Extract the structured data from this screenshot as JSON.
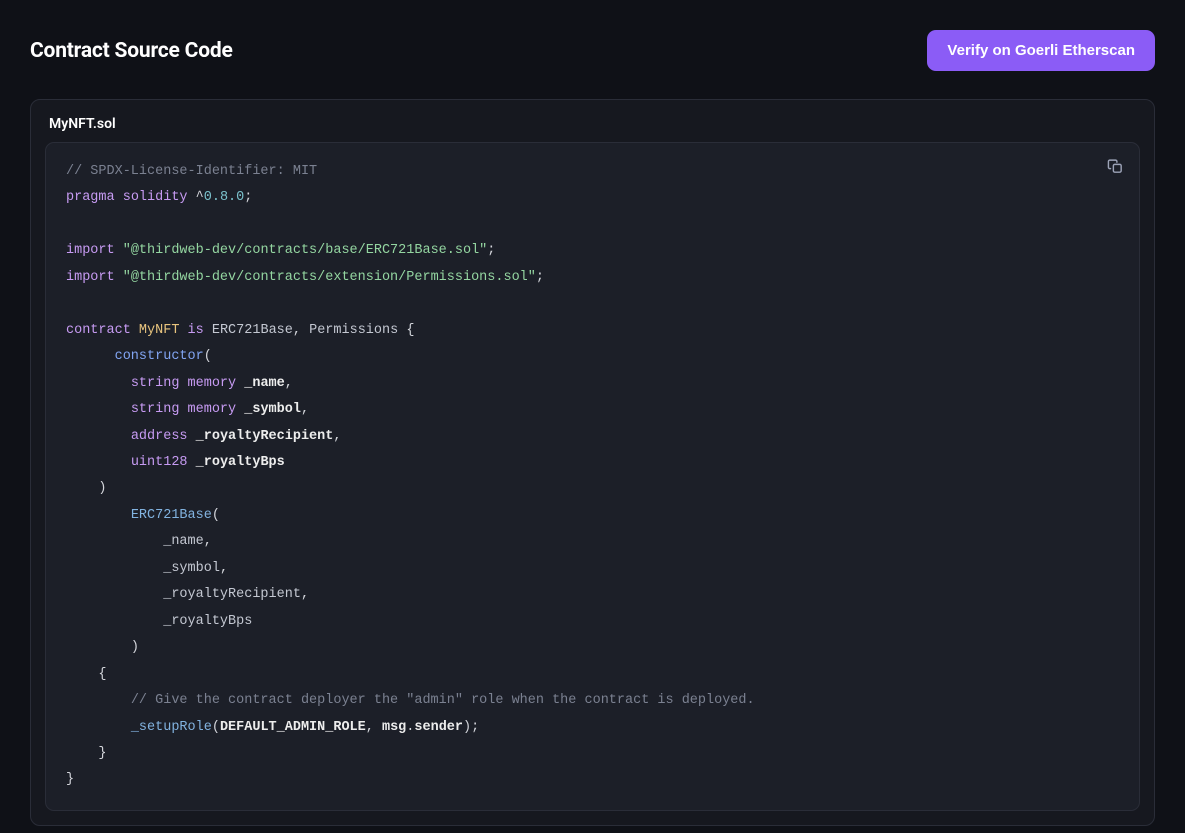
{
  "header": {
    "title": "Contract Source Code",
    "verify_label": "Verify on Goerli Etherscan"
  },
  "source": {
    "filename": "MyNFT.sol",
    "code": {
      "line1_comment": "// SPDX-License-Identifier: MIT",
      "line2_kw1": "pragma",
      "line2_kw2": "solidity",
      "line2_caret": "^",
      "line2_ver": "0.8.0",
      "line2_semi": ";",
      "import_kw": "import",
      "import1_str": "\"@thirdweb-dev/contracts/base/ERC721Base.sol\"",
      "import2_str": "\"@thirdweb-dev/contracts/extension/Permissions.sol\"",
      "semi": ";",
      "contract_kw": "contract",
      "contract_name": "MyNFT",
      "is_kw": "is",
      "base1": "ERC721Base",
      "base2": "Permissions",
      "lbrace": "{",
      "rbrace": "}",
      "comma": ",",
      "constructor_kw": "constructor",
      "lparen": "(",
      "rparen": ")",
      "string_kw": "string",
      "memory_kw": "memory",
      "address_kw": "address",
      "uint128_kw": "uint128",
      "p1": "_name",
      "p2": "_symbol",
      "p3": "_royaltyRecipient",
      "p4": "_royaltyBps",
      "erc721base_fn": "ERC721Base",
      "body_comment": "// Give the contract deployer the \"admin\" role when the contract is deployed.",
      "setupRole_fn": "_setupRole",
      "default_admin": "DEFAULT_ADMIN_ROLE",
      "msg": "msg",
      "dot": ".",
      "sender": "sender"
    }
  }
}
